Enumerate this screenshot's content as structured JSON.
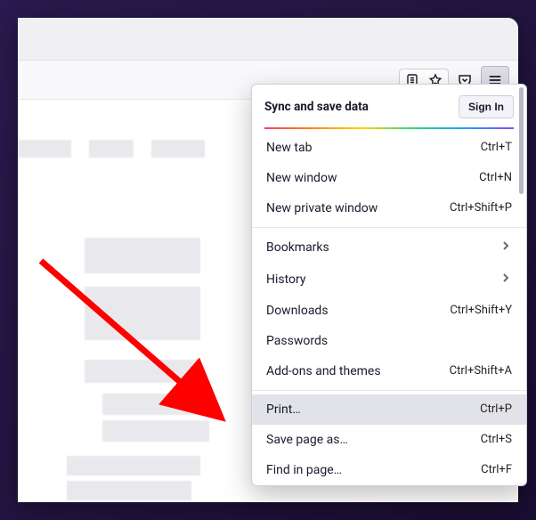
{
  "sync": {
    "title": "Sync and save data",
    "signin_label": "Sign In"
  },
  "menu": {
    "new_tab": {
      "label": "New tab",
      "shortcut": "Ctrl+T"
    },
    "new_window": {
      "label": "New window",
      "shortcut": "Ctrl+N"
    },
    "new_private": {
      "label": "New private window",
      "shortcut": "Ctrl+Shift+P"
    },
    "bookmarks": {
      "label": "Bookmarks"
    },
    "history": {
      "label": "History"
    },
    "downloads": {
      "label": "Downloads",
      "shortcut": "Ctrl+Shift+Y"
    },
    "passwords": {
      "label": "Passwords"
    },
    "addons": {
      "label": "Add-ons and themes",
      "shortcut": "Ctrl+Shift+A"
    },
    "print": {
      "label": "Print…",
      "shortcut": "Ctrl+P"
    },
    "save_as": {
      "label": "Save page as…",
      "shortcut": "Ctrl+S"
    },
    "find": {
      "label": "Find in page…",
      "shortcut": "Ctrl+F"
    }
  },
  "annotation": {
    "target": "print-menu-item"
  }
}
